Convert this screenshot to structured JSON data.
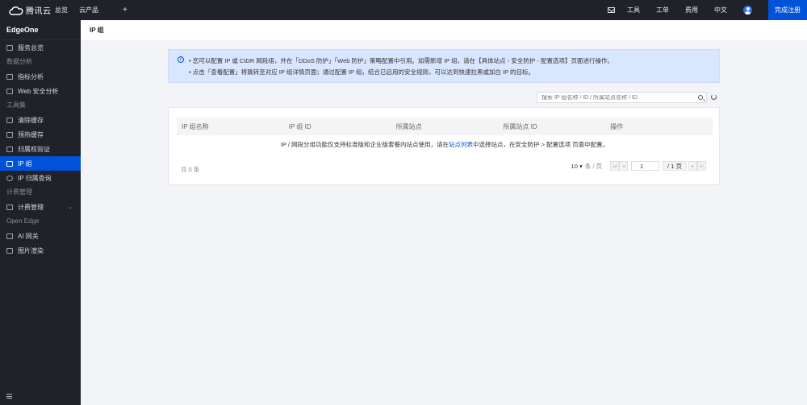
{
  "topbar": {
    "brand": "腾讯云",
    "nav": [
      "总览",
      "云产品"
    ],
    "plus": "+",
    "right": [
      "工具",
      "工单",
      "费用",
      "中文"
    ],
    "register": "完成注册"
  },
  "sidebar": {
    "title": "EdgeOne",
    "items": [
      {
        "type": "item",
        "label": "服务总览",
        "icon": "grid-icon"
      },
      {
        "type": "group",
        "label": "数据分析"
      },
      {
        "type": "item",
        "label": "指标分析",
        "icon": "chart-icon"
      },
      {
        "type": "item",
        "label": "Web 安全分析",
        "icon": "shield-icon"
      },
      {
        "type": "group",
        "label": "工具集"
      },
      {
        "type": "item",
        "label": "清除缓存",
        "icon": "refresh-icon"
      },
      {
        "type": "item",
        "label": "预热缓存",
        "icon": "fire-icon"
      },
      {
        "type": "item",
        "label": "归属权验证",
        "icon": "check-icon"
      },
      {
        "type": "item",
        "label": "IP 组",
        "icon": "ip-icon",
        "active": true
      },
      {
        "type": "item",
        "label": "IP 归属查询",
        "icon": "search-icon"
      },
      {
        "type": "group",
        "label": "计费管理"
      },
      {
        "type": "item",
        "label": "计费管理",
        "icon": "bill-icon",
        "chevron": "⌄"
      },
      {
        "type": "group",
        "label": "Open Edge"
      },
      {
        "type": "item",
        "label": "AI 网关",
        "icon": "ai-icon"
      },
      {
        "type": "item",
        "label": "图片渲染",
        "icon": "image-icon"
      }
    ]
  },
  "page": {
    "title": "IP 组"
  },
  "banner": {
    "line1": "• 您可以配置 IP 或 CIDR 网段组，并在「DDoS 防护」「Web 防护」策略配置中引用。如需新增 IP 组，请在【具体站点 - 安全防护 - 配置选项】页面进行操作。",
    "line2": "• 点击「查看配置」将跳转至对应 IP 组详情页面；通过配置 IP 组，结合已启用的安全规则，可以达到快速拉黑或加白 IP 的目标。"
  },
  "search": {
    "placeholder": "搜索 IP 组名称 / ID / 所属站点名称 / ID"
  },
  "table": {
    "columns": [
      "IP 组名称",
      "IP 组 ID",
      "所属站点",
      "所属站点 ID",
      "操作"
    ],
    "empty_before": "IP / 网段分组功能仅支持标准版和企业版套餐内站点使用，请在",
    "empty_link": "站点列表",
    "empty_after": "中选择站点，在安全防护 > 配置选项 页面中配置。",
    "total": "共 0 条"
  },
  "pagination": {
    "page_size": "10 ▾",
    "unit": "条 / 页",
    "first": "|◂",
    "prev": "◂",
    "current": "1",
    "total": "/ 1 页",
    "next": "▸",
    "last": "▸|"
  }
}
